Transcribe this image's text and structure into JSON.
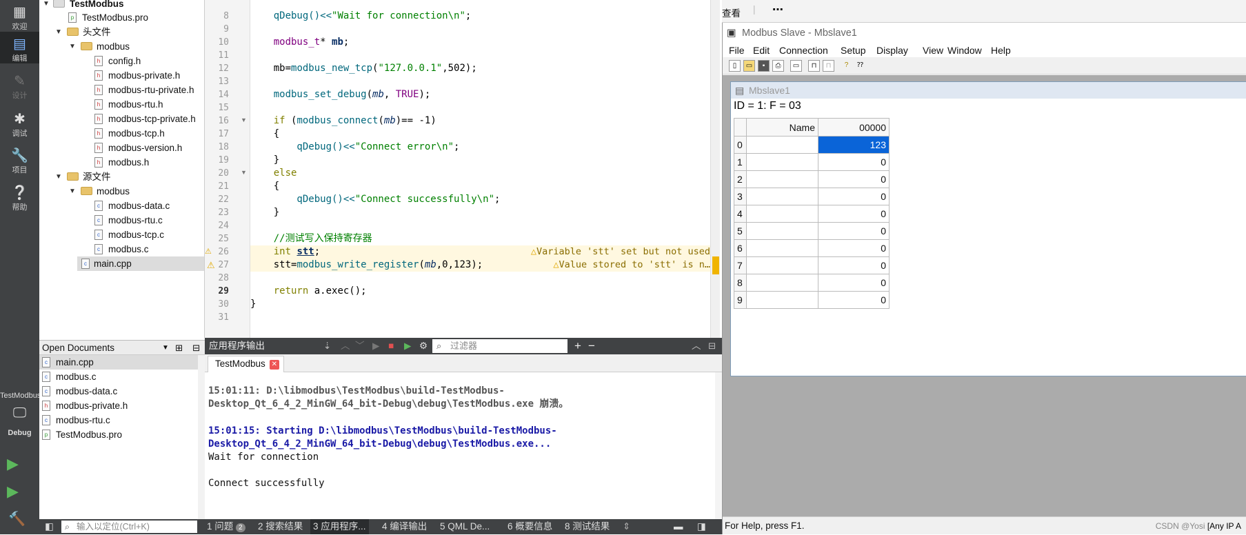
{
  "modebar": {
    "modes": [
      {
        "label": "欢迎",
        "icon": "grid-icon"
      },
      {
        "label": "编辑",
        "icon": "edit-icon"
      },
      {
        "label": "设计",
        "icon": "pen-icon"
      },
      {
        "label": "调试",
        "icon": "bug-icon"
      },
      {
        "label": "项目",
        "icon": "wrench-icon"
      },
      {
        "label": "帮助",
        "icon": "help-icon"
      }
    ],
    "kit_label": "TestModbus",
    "kit_mode": "Debug"
  },
  "tree": {
    "project": "TestModbus",
    "pro_file": "TestModbus.pro",
    "headers_folder": "头文件",
    "headers_sub": "modbus",
    "headers": [
      "config.h",
      "modbus-private.h",
      "modbus-rtu-private.h",
      "modbus-rtu.h",
      "modbus-tcp-private.h",
      "modbus-tcp.h",
      "modbus-version.h",
      "modbus.h"
    ],
    "sources_folder": "源文件",
    "sources_sub": "modbus",
    "sources": [
      "modbus-data.c",
      "modbus-rtu.c",
      "modbus-tcp.c",
      "modbus.c"
    ],
    "main": "main.cpp"
  },
  "open_documents": {
    "title": "Open Documents",
    "items": [
      "main.cpp",
      "modbus.c",
      "modbus-data.c",
      "modbus-private.h",
      "modbus-rtu.c",
      "TestModbus.pro"
    ]
  },
  "editor": {
    "line_numbers": [
      "8",
      "9",
      "10",
      "11",
      "12",
      "13",
      "14",
      "15",
      "16",
      "17",
      "18",
      "19",
      "20",
      "21",
      "22",
      "23",
      "24",
      "25",
      "26",
      "27",
      "28",
      "29",
      "30",
      "31"
    ],
    "current_line": "29",
    "warn1": "Variable 'stt' set but not used",
    "warn2": "Value stored to 'stt' is n…",
    "code": {
      "l8a": "    qDebug()<<",
      "l8b": "\"Wait for connection\\n\"",
      "l8c": ";",
      "l10a": "    modbus_t",
      "l10b": "* ",
      "l10c": "mb",
      "l10d": ";",
      "l12a": "    mb=",
      "l12b": "modbus_new_tcp",
      "l12c": "(",
      "l12d": "\"127.0.0.1\"",
      "l12e": ",502);",
      "l14a": "    ",
      "l14b": "modbus_set_debug",
      "l14c": "(",
      "l14d": "mb",
      "l14e": ", ",
      "l14f": "TRUE",
      "l14g": ");",
      "l16a": "    ",
      "l16b": "if",
      "l16c": " (",
      "l16d": "modbus_connect",
      "l16e": "(",
      "l16f": "mb",
      "l16g": ")== -1)",
      "l17": "    {",
      "l18a": "        qDebug()<<",
      "l18b": "\"Connect error\\n\"",
      "l18c": ";",
      "l19": "    }",
      "l20": "    else",
      "l21": "    {",
      "l22a": "        qDebug()<<",
      "l22b": "\"Connect successfully\\n\"",
      "l22c": ";",
      "l23": "    }",
      "l25": "    //测试写入保持寄存器",
      "l26a": "    ",
      "l26b": "int",
      "l26c": " ",
      "l26d": "stt",
      "l26e": ";",
      "l27a": "    stt=",
      "l27b": "modbus_write_register",
      "l27c": "(",
      "l27d": "mb",
      "l27e": ",0,123);",
      "l29a": "    ",
      "l29b": "return",
      "l29c": " a.exec();",
      "l30": "}"
    }
  },
  "output": {
    "title": "应用程序输出",
    "filter_placeholder": "过滤器",
    "tab": "TestModbus",
    "lines": [
      "15:01:11: D:\\libmodbus\\TestModbus\\build-TestModbus-",
      "Desktop_Qt_6_4_2_MinGW_64_bit-Debug\\debug\\TestModbus.exe 崩溃。",
      "15:01:15: Starting D:\\libmodbus\\TestModbus\\build-TestModbus-",
      "Desktop_Qt_6_4_2_MinGW_64_bit-Debug\\debug\\TestModbus.exe...",
      "Wait for connection",
      "Connect successfully"
    ]
  },
  "status": {
    "locator_placeholder": "输入以定位(Ctrl+K)",
    "tabs": [
      {
        "label": "1 问题",
        "badge": "2"
      },
      {
        "label": "2 搜索结果"
      },
      {
        "label": "3 应用程序..."
      },
      {
        "label": "4 编译输出"
      },
      {
        "label": "5 QML De..."
      },
      {
        "label": "6 概要信息"
      },
      {
        "label": "8 测试结果"
      }
    ]
  },
  "slave": {
    "top_label": "查看",
    "title": "Modbus Slave - Mbslave1",
    "menu": [
      "File",
      "Edit",
      "Connection",
      "Setup",
      "Display",
      "View",
      "Window",
      "Help"
    ],
    "child_title": "Mbslave1",
    "id_line": "ID = 1: F = 03",
    "col_name": "Name",
    "col_addr": "00000",
    "rows": [
      {
        "idx": "0",
        "value": "123"
      },
      {
        "idx": "1",
        "value": "0"
      },
      {
        "idx": "2",
        "value": "0"
      },
      {
        "idx": "3",
        "value": "0"
      },
      {
        "idx": "4",
        "value": "0"
      },
      {
        "idx": "5",
        "value": "0"
      },
      {
        "idx": "6",
        "value": "0"
      },
      {
        "idx": "7",
        "value": "0"
      },
      {
        "idx": "8",
        "value": "0"
      },
      {
        "idx": "9",
        "value": "0"
      }
    ],
    "status_text": "For Help, press F1.",
    "watermark": "CSDN @Yosi",
    "watermark2": "[Any IP A"
  },
  "colors": {
    "accent": "#0a64d8",
    "sidebar": "#404244"
  }
}
